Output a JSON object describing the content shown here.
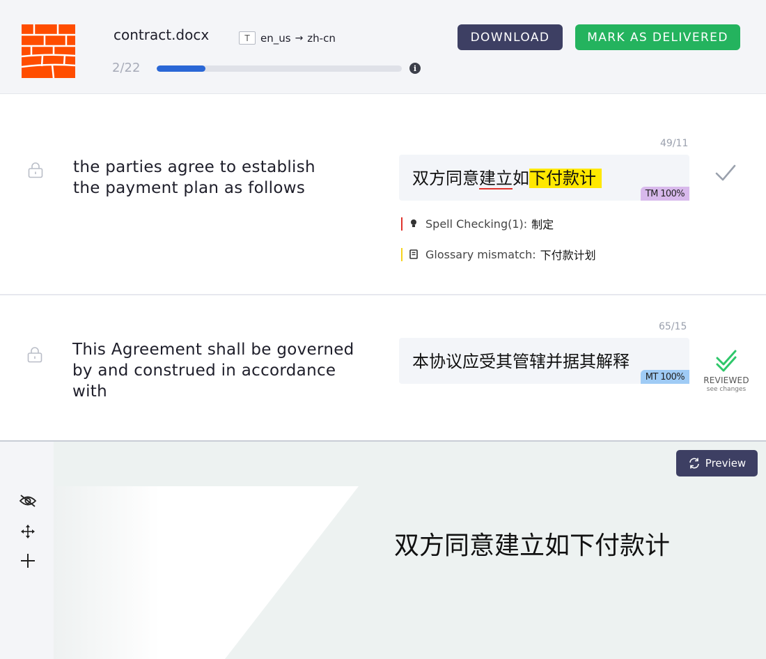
{
  "header": {
    "filename": "contract.docx",
    "format_icon": "T",
    "source_lang": "en_us",
    "target_lang": "zh-cn",
    "counter": "2/22",
    "progress_fraction": 0.2,
    "download_label": "DOWNLOAD",
    "deliver_label": "MARK AS DELIVERED",
    "colors": {
      "logo": "#ff4d00",
      "download": "#3d3f63",
      "deliver": "#24b35e",
      "progress": "#2a67d6"
    }
  },
  "segments": [
    {
      "source": [
        "the parties agree to establish",
        "the payment plan as follows"
      ],
      "count": "49/11",
      "target_parts": {
        "a": "双方同意",
        "b": "建立",
        "c": "如",
        "d": "下付款计"
      },
      "badge": "TM 100%",
      "qa": [
        {
          "label": "Spell Checking(1):",
          "value": "制定",
          "icon": "bulb-icon",
          "color": "#e0332c"
        },
        {
          "label": "Glossary mismatch:",
          "value": "下付款计划",
          "icon": "book-icon",
          "color": "#f6d31d"
        }
      ]
    },
    {
      "source": [
        "This Agreement shall be governed",
        "by and construed in accordance",
        "with"
      ],
      "count": "65/15",
      "target": "本协议应受其管辖并据其解释",
      "badge": "MT 100%",
      "reviewed_label": "REVIEWED",
      "reviewed_sub": "see changes"
    }
  ],
  "preview": {
    "button_label": "Preview",
    "text": "双方同意建立如下付款计"
  }
}
